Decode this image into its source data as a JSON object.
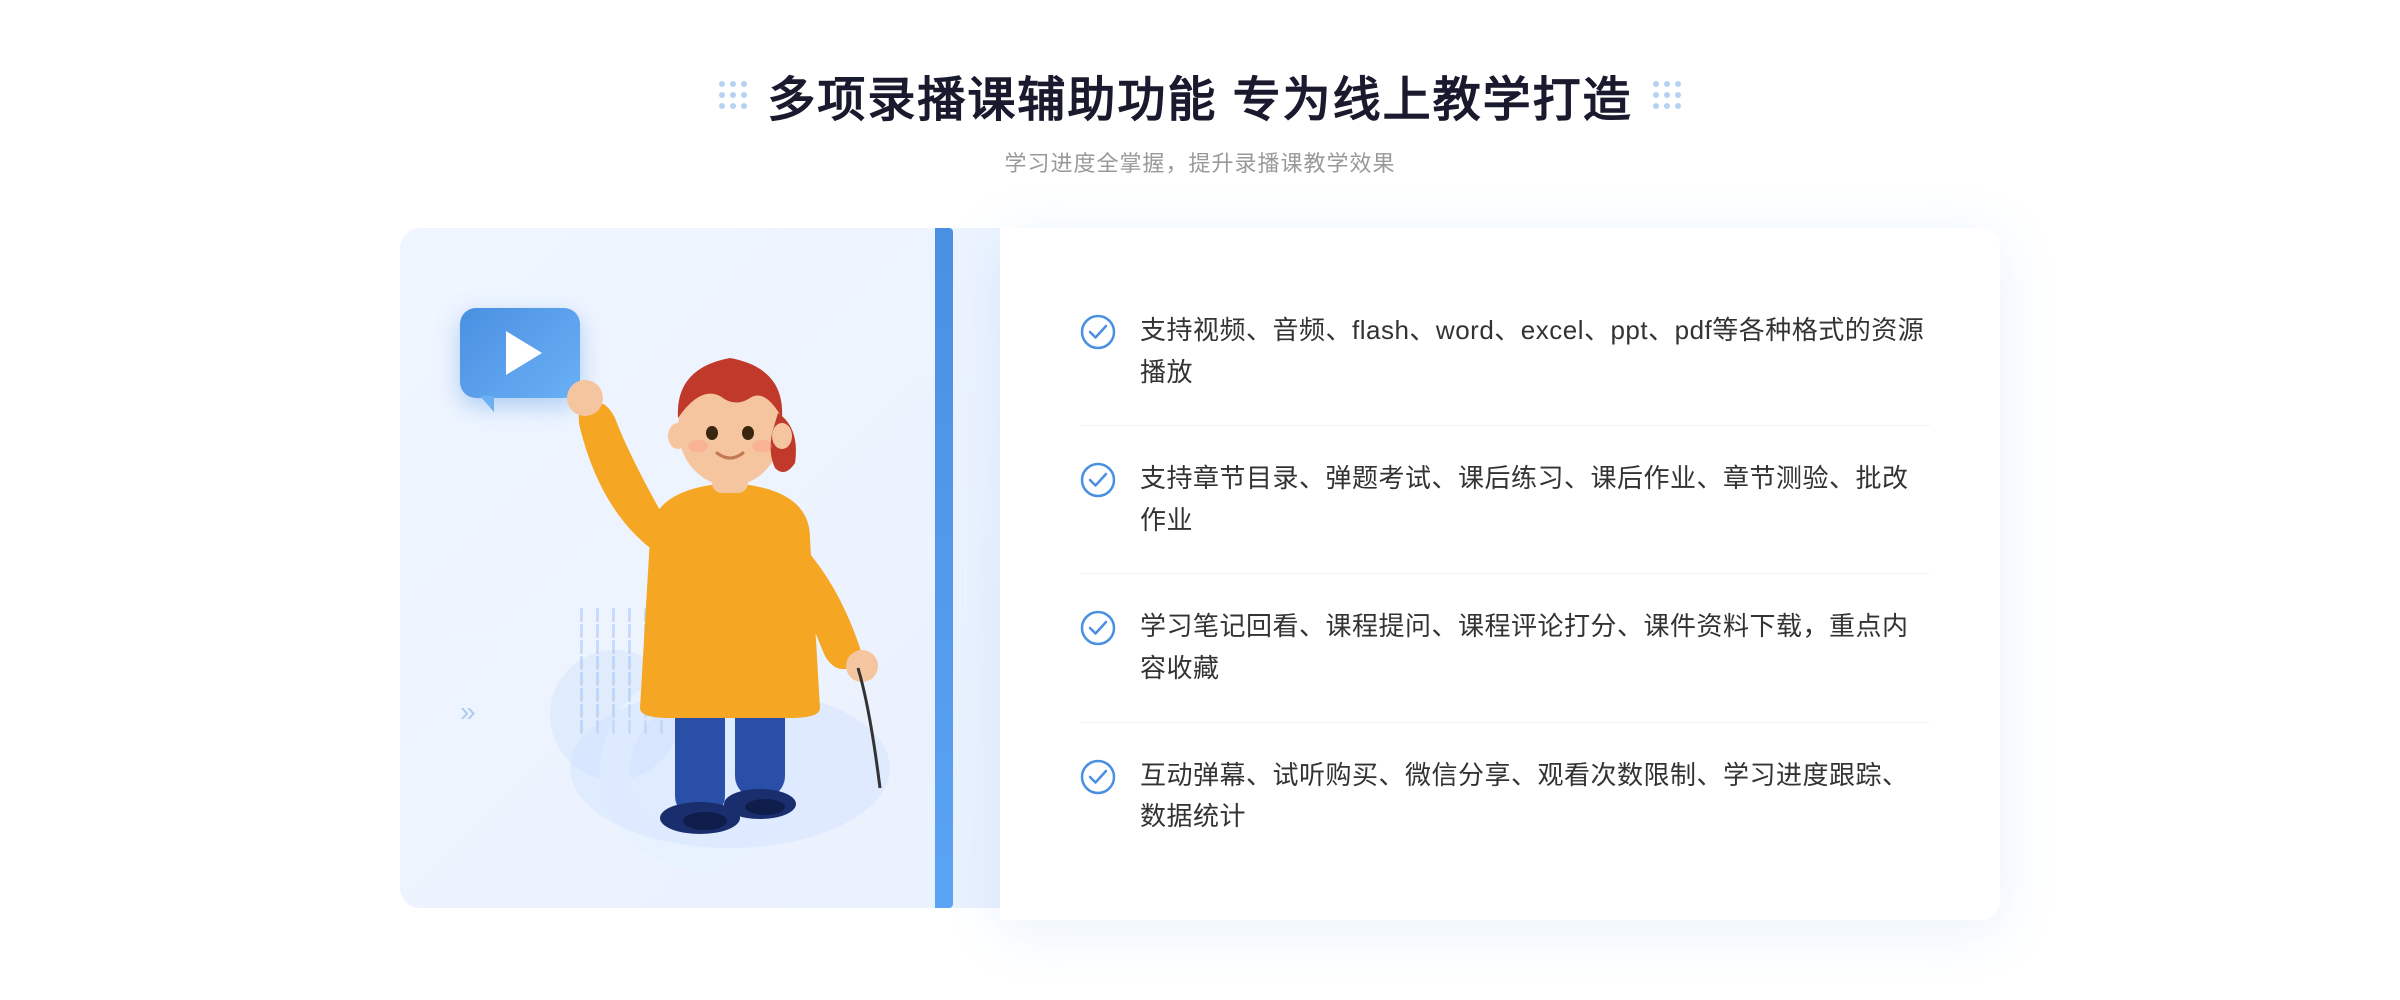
{
  "header": {
    "main_title": "多项录播课辅助功能 专为线上教学打造",
    "sub_title": "学习进度全掌握，提升录播课教学效果"
  },
  "features": [
    {
      "id": 1,
      "text": "支持视频、音频、flash、word、excel、ppt、pdf等各种格式的资源播放"
    },
    {
      "id": 2,
      "text": "支持章节目录、弹题考试、课后练习、课后作业、章节测验、批改作业"
    },
    {
      "id": 3,
      "text": "学习笔记回看、课程提问、课程评论打分、课件资料下载，重点内容收藏"
    },
    {
      "id": 4,
      "text": "互动弹幕、试听购买、微信分享、观看次数限制、学习进度跟踪、数据统计"
    }
  ],
  "colors": {
    "primary_blue": "#4a90e2",
    "light_blue": "#e8f2ff",
    "text_dark": "#1a1a2e",
    "text_mid": "#333333",
    "text_light": "#999999"
  }
}
